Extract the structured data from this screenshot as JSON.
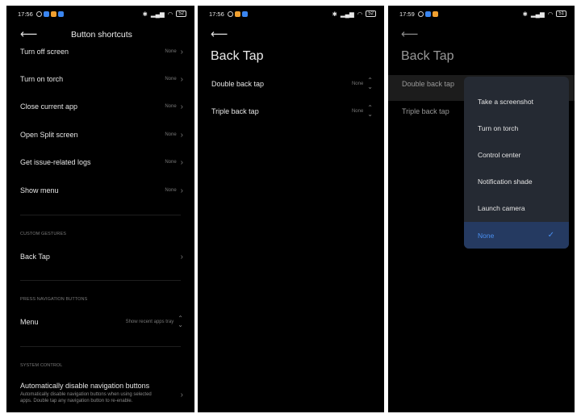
{
  "screen1": {
    "time": "17:56",
    "battery": "52",
    "title": "Button shortcuts",
    "items": [
      {
        "label": "Turn off screen",
        "value": "None"
      },
      {
        "label": "Turn on torch",
        "value": "None"
      },
      {
        "label": "Close current app",
        "value": "None"
      },
      {
        "label": "Open Split screen",
        "value": "None"
      },
      {
        "label": "Get issue-related logs",
        "value": "None"
      },
      {
        "label": "Show menu",
        "value": "None"
      }
    ],
    "section_gestures": "CUSTOM GESTURES",
    "back_tap": "Back Tap",
    "section_nav": "PRESS NAVIGATION BUTTONS",
    "menu_label": "Menu",
    "menu_value": "Show recent apps tray",
    "section_system": "SYSTEM CONTROL",
    "auto_disable_title": "Automatically disable navigation buttons",
    "auto_disable_desc": "Automatically disable navigation buttons when using selected apps. Double tap any navigation button to re-enable."
  },
  "screen2": {
    "time": "17:56",
    "battery": "52",
    "title": "Back Tap",
    "items": [
      {
        "label": "Double back tap",
        "value": "None"
      },
      {
        "label": "Triple back tap",
        "value": "None"
      }
    ]
  },
  "screen3": {
    "time": "17:59",
    "battery": "51",
    "title": "Back Tap",
    "items": [
      {
        "label": "Double back tap"
      },
      {
        "label": "Triple back tap"
      }
    ],
    "options": [
      "Take a screenshot",
      "Turn on torch",
      "Control center",
      "Notification shade",
      "Launch camera",
      "None"
    ],
    "selected_option": "None"
  },
  "colors": {
    "background": "#000000",
    "popup": "#252a33",
    "selected_bg": "#253a61",
    "accent": "#4a8ff0"
  },
  "icons": {
    "back": "arrow-left-icon",
    "chevron": "chevron-right-icon",
    "updown": "up-down-chevron-icon",
    "check": "checkmark-icon"
  }
}
